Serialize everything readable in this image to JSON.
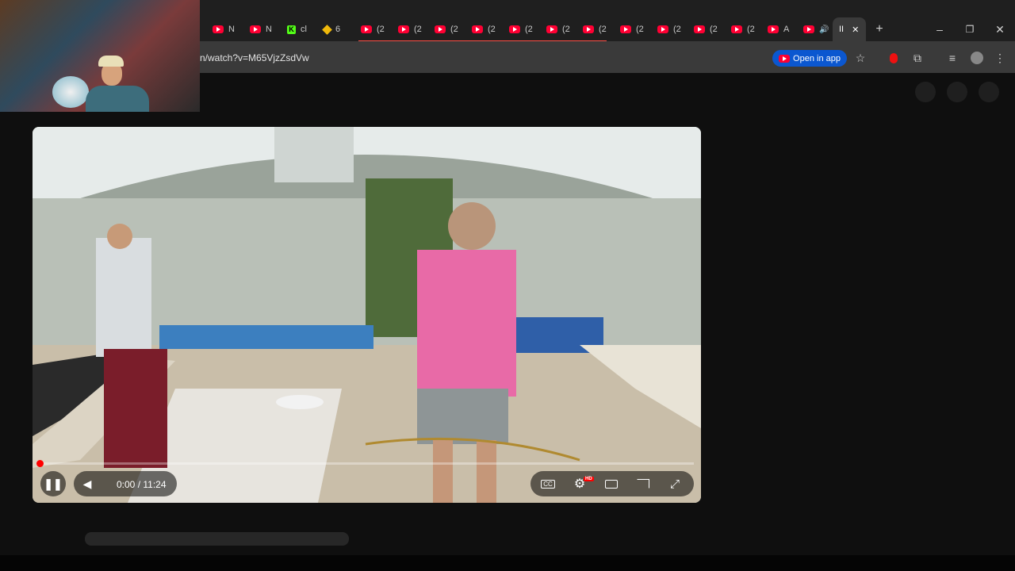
{
  "tabs": [
    {
      "icon": "youtube-icon",
      "label": "N"
    },
    {
      "icon": "youtube-icon",
      "label": "N"
    },
    {
      "icon": "kick-icon",
      "label": "cl"
    },
    {
      "icon": "binance-icon",
      "label": "6"
    },
    {
      "icon": "youtube-icon",
      "label": "(2"
    },
    {
      "icon": "youtube-icon",
      "label": "(2"
    },
    {
      "icon": "youtube-icon",
      "label": "(2"
    },
    {
      "icon": "youtube-icon",
      "label": "(2"
    },
    {
      "icon": "youtube-icon",
      "label": "(2"
    },
    {
      "icon": "youtube-icon",
      "label": "(2"
    },
    {
      "icon": "youtube-icon",
      "label": "(2"
    },
    {
      "icon": "youtube-icon",
      "label": "(2"
    },
    {
      "icon": "youtube-icon",
      "label": "(2"
    },
    {
      "icon": "youtube-icon",
      "label": "(2"
    },
    {
      "icon": "youtube-icon",
      "label": "(2"
    },
    {
      "icon": "youtube-icon",
      "label": "A"
    }
  ],
  "active_tab": {
    "label": "II"
  },
  "address": {
    "url": "n/watch?v=M65VjzZsdVw",
    "open_in_app": "Open in app"
  },
  "player": {
    "time": "0:00 / 11:24",
    "progress_fraction": 0.0,
    "hd_badge": "HD"
  },
  "colors": {
    "brand_red": "#ff0000",
    "accent_blue": "#0b57d0"
  }
}
